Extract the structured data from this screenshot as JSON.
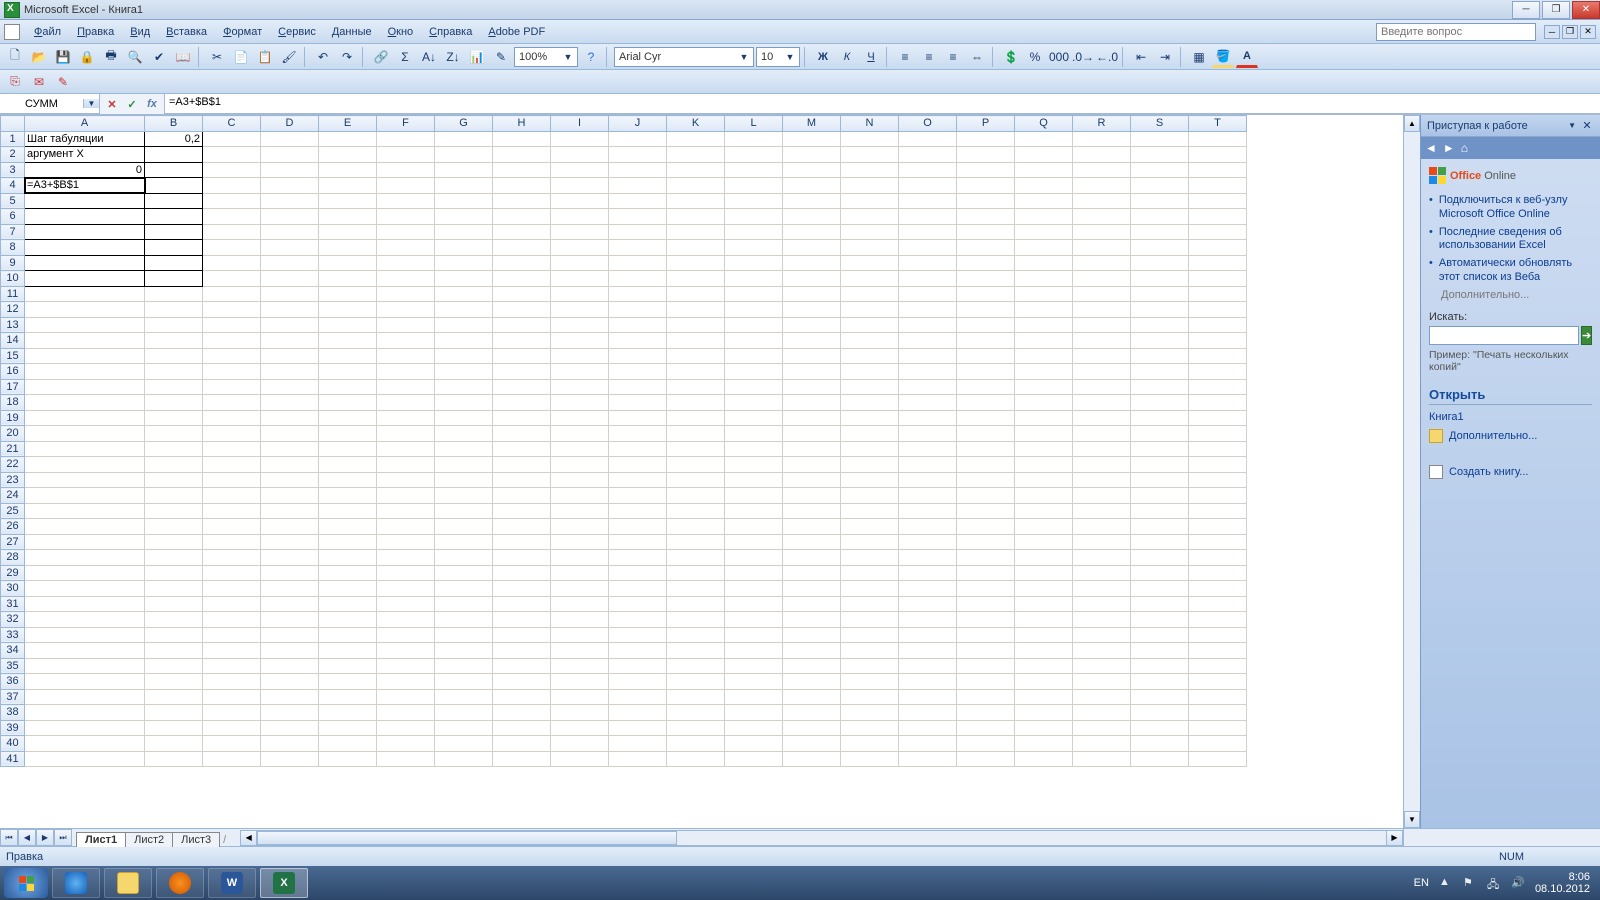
{
  "title": "Microsoft Excel - Книга1",
  "menu": [
    "Файл",
    "Правка",
    "Вид",
    "Вставка",
    "Формат",
    "Сервис",
    "Данные",
    "Окно",
    "Справка",
    "Adobe PDF"
  ],
  "question_placeholder": "Введите вопрос",
  "zoom": "100%",
  "font_name": "Arial Cyr",
  "font_size": "10",
  "name_box": "СУММ",
  "formula": "=A3+$B$1",
  "columns": [
    "A",
    "B",
    "C",
    "D",
    "E",
    "F",
    "G",
    "H",
    "I",
    "J",
    "K",
    "L",
    "M",
    "N",
    "O",
    "P",
    "Q",
    "R",
    "S",
    "T"
  ],
  "row_count": 41,
  "cells": {
    "A1": "Шаг табуляции",
    "B1": "0,2",
    "A2": "аргумент X",
    "A3": "0",
    "A4": "=A3+$B$1"
  },
  "boxed_range": {
    "r1": 1,
    "r2": 10,
    "c1": 1,
    "c2": 2
  },
  "editing_cell": "A4",
  "sheets": [
    "Лист1",
    "Лист2",
    "Лист3"
  ],
  "active_sheet": 0,
  "status_left": "Правка",
  "status_num": "NUM",
  "taskpane": {
    "title": "Приступая к работе",
    "logo": "Office Online",
    "links": [
      "Подключиться к веб-узлу Microsoft Office Online",
      "Последние сведения об использовании Excel",
      "Автоматически обновлять этот список из Веба"
    ],
    "more": "Дополнительно...",
    "search_label": "Искать:",
    "example": "Пример: \"Печать нескольких копий\"",
    "open_header": "Открыть",
    "recent": "Книга1",
    "open_more": "Дополнительно...",
    "create": "Создать книгу..."
  },
  "tray": {
    "lang": "EN",
    "time": "8:06",
    "date": "08.10.2012"
  }
}
